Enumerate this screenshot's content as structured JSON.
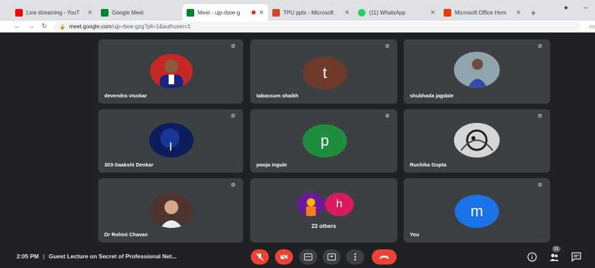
{
  "browser": {
    "tabs": [
      {
        "title": "Live streaming - YouT",
        "favicon": "youtube-icon",
        "color": "#ff0000"
      },
      {
        "title": "Google Meet",
        "favicon": "meet-icon",
        "color": "#00832d"
      },
      {
        "title": "Meet - ujp-rboe-g",
        "favicon": "meet-icon",
        "color": "#00832d",
        "active": true
      },
      {
        "title": "TPU pptx - Microsoft",
        "favicon": "powerpoint-icon",
        "color": "#d24726"
      },
      {
        "title": "(11) WhatsApp",
        "favicon": "whatsapp-icon",
        "color": "#25d366"
      },
      {
        "title": "Microsoft Office Hom",
        "favicon": "office-icon",
        "color": "#eb3c00"
      }
    ],
    "url_host": "meet.google.com",
    "url_path": "/ujp-rboe-gzg?pli=1&authuser=1"
  },
  "participants": [
    {
      "name": "devendra visokar",
      "type": "photo"
    },
    {
      "name": "tabassum shaikh",
      "type": "letter",
      "letter": "t",
      "color": "#6e3b2a"
    },
    {
      "name": "shubhada jagdale",
      "type": "photo"
    },
    {
      "name": "303-Saakshi Deokar",
      "type": "photo"
    },
    {
      "name": "pooja ingule",
      "type": "letter",
      "letter": "p",
      "color": "#1e8e3e"
    },
    {
      "name": "Ruchika Gupta",
      "type": "photo"
    },
    {
      "name": "Dr Rohini Chavan",
      "type": "photo"
    },
    {
      "name": "23 others",
      "type": "group",
      "letter": "h",
      "color": "#d81b60"
    },
    {
      "name": "You",
      "type": "letter",
      "letter": "m",
      "color": "#1a73e8"
    }
  ],
  "bottombar": {
    "time": "2:05 PM",
    "meeting_title": "Guest Lecture on Secret of Professional Net...",
    "people_count": "31"
  },
  "colors": {
    "stage_bg": "#202124",
    "tile_bg": "#3c4043",
    "danger": "#ea4335"
  }
}
